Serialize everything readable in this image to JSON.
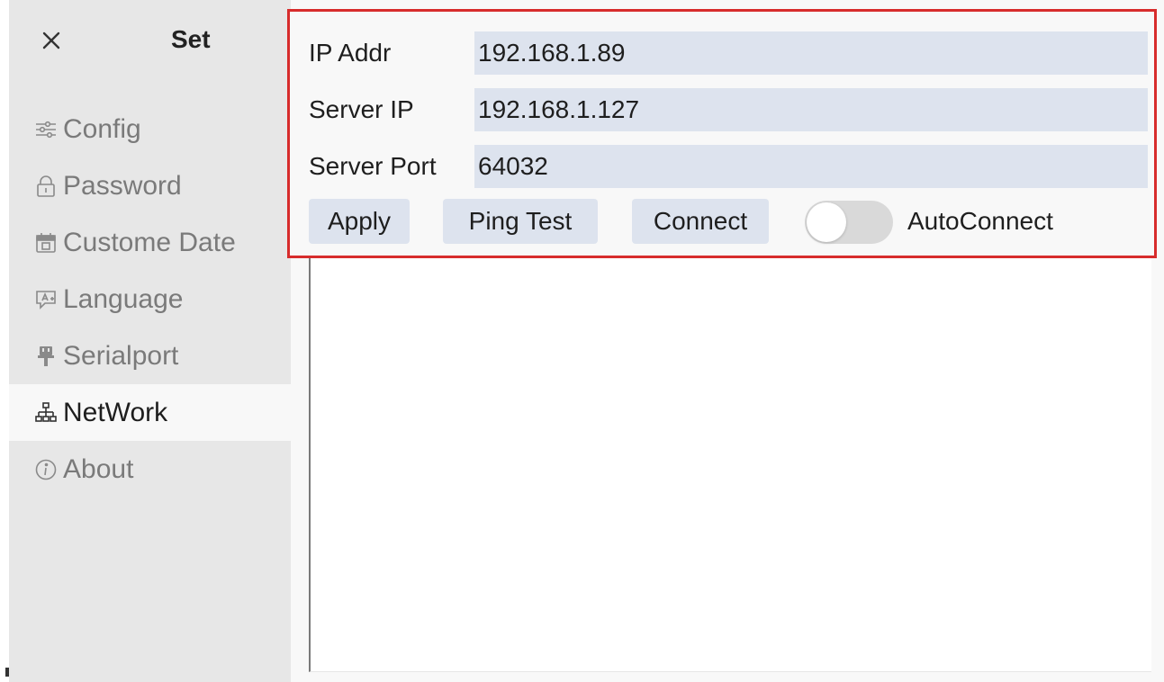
{
  "sidebar": {
    "title": "Set",
    "items": [
      {
        "label": "Config",
        "icon": "sliders-icon",
        "active": false
      },
      {
        "label": "Password",
        "icon": "lock-icon",
        "active": false
      },
      {
        "label": "Custome Date",
        "icon": "calendar-icon",
        "active": false
      },
      {
        "label": "Language",
        "icon": "language-icon",
        "active": false
      },
      {
        "label": "Serialport",
        "icon": "plug-icon",
        "active": false
      },
      {
        "label": "NetWork",
        "icon": "network-icon",
        "active": true
      },
      {
        "label": "About",
        "icon": "info-icon",
        "active": false
      }
    ]
  },
  "network": {
    "ip_addr": {
      "label": "IP Addr",
      "value": "192.168.1.89"
    },
    "server_ip": {
      "label": "Server IP",
      "value": "192.168.1.127"
    },
    "server_port": {
      "label": "Server Port",
      "value": "64032"
    },
    "buttons": {
      "apply": "Apply",
      "ping_test": "Ping Test",
      "connect": "Connect"
    },
    "autoconnect": {
      "label": "AutoConnect",
      "enabled": false
    }
  },
  "colors": {
    "highlight_border": "#d72c2c",
    "field_background": "#dde3ee",
    "sidebar_background": "#e7e7e7"
  }
}
